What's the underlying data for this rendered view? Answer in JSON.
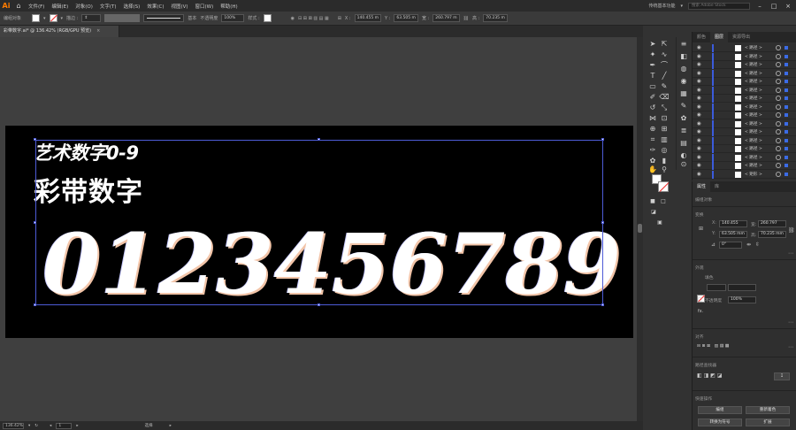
{
  "app": {
    "logo": "Ai",
    "title_right": "传统基本功能",
    "search_placeholder": "搜索 Adobe Stock"
  },
  "menu": [
    "文件(F)",
    "编辑(E)",
    "对象(O)",
    "文字(T)",
    "选择(S)",
    "效果(C)",
    "视图(V)",
    "窗口(W)",
    "帮助(H)"
  ],
  "control": {
    "group_label": "编组对象",
    "stroke_label": "描边 :",
    "stroke_style": "基本",
    "opacity_label": "不透明度",
    "opacity_value": "100%",
    "style_label": "样式 :",
    "x_label": "X :",
    "x_value": "140.455 m",
    "y_label": "Y :",
    "y_value": "63.505 m",
    "w_label": "宽 :",
    "w_value": "260.797 m",
    "h_label": "高 :",
    "h_value": "70.235 m"
  },
  "document": {
    "tab_title": "彩带数字.ai* @ 136.42% (RGB/GPU 预览)",
    "close": "×"
  },
  "artwork": {
    "title1": "艺术数字0-9",
    "title2": "彩带数字",
    "digits": [
      "0",
      "1",
      "2",
      "3",
      "4",
      "5",
      "6",
      "7",
      "8",
      "9"
    ]
  },
  "status": {
    "zoom": "136.42%",
    "page": "1",
    "mode": "选择"
  },
  "layers": {
    "tabs": [
      "颜色",
      "图层",
      "资源导出"
    ],
    "rows": [
      {
        "name": "< 路径 >"
      },
      {
        "name": "< 路径 >"
      },
      {
        "name": "< 路径 >"
      },
      {
        "name": "< 路径 >"
      },
      {
        "name": "< 路径 >"
      },
      {
        "name": "< 路径 >"
      },
      {
        "name": "< 路径 >"
      },
      {
        "name": "< 路径 >"
      },
      {
        "name": "< 路径 >"
      },
      {
        "name": "< 路径 >"
      },
      {
        "name": "< 路径 >"
      },
      {
        "name": "< 路径 >"
      },
      {
        "name": "< 路径 >"
      },
      {
        "name": "< 路径 >"
      },
      {
        "name": "< 路径 >"
      },
      {
        "name": "< 矩形 >"
      }
    ]
  },
  "properties": {
    "tabs": [
      "属性",
      "库"
    ],
    "object_type": "编组对象",
    "transform_label": "变换",
    "x_label": "X:",
    "x": "140.455",
    "y_label": "Y:",
    "y": "63.505 mm",
    "w_label": "宽:",
    "w": "260.797",
    "h_label": "高:",
    "h": "70.235 mm",
    "angle": "0°",
    "appearance_label": "外观",
    "fill_label": "填色",
    "stroke_label": "描边",
    "opacity_label": "不透明度",
    "opacity": "100%",
    "fx": "fx.",
    "align_label": "对齐",
    "pathfinder_label": "路径查找器",
    "quick_actions_label": "快速操作",
    "btn_edit": "编组",
    "btn_recolor": "重新着色",
    "btn_symbol": "转换为符号",
    "btn_expand": "扩展"
  },
  "colors": {
    "accent": "#ff7c00",
    "selection": "#4d5bd6",
    "canvas": "#3f3f3f",
    "artboard": "#000000"
  }
}
